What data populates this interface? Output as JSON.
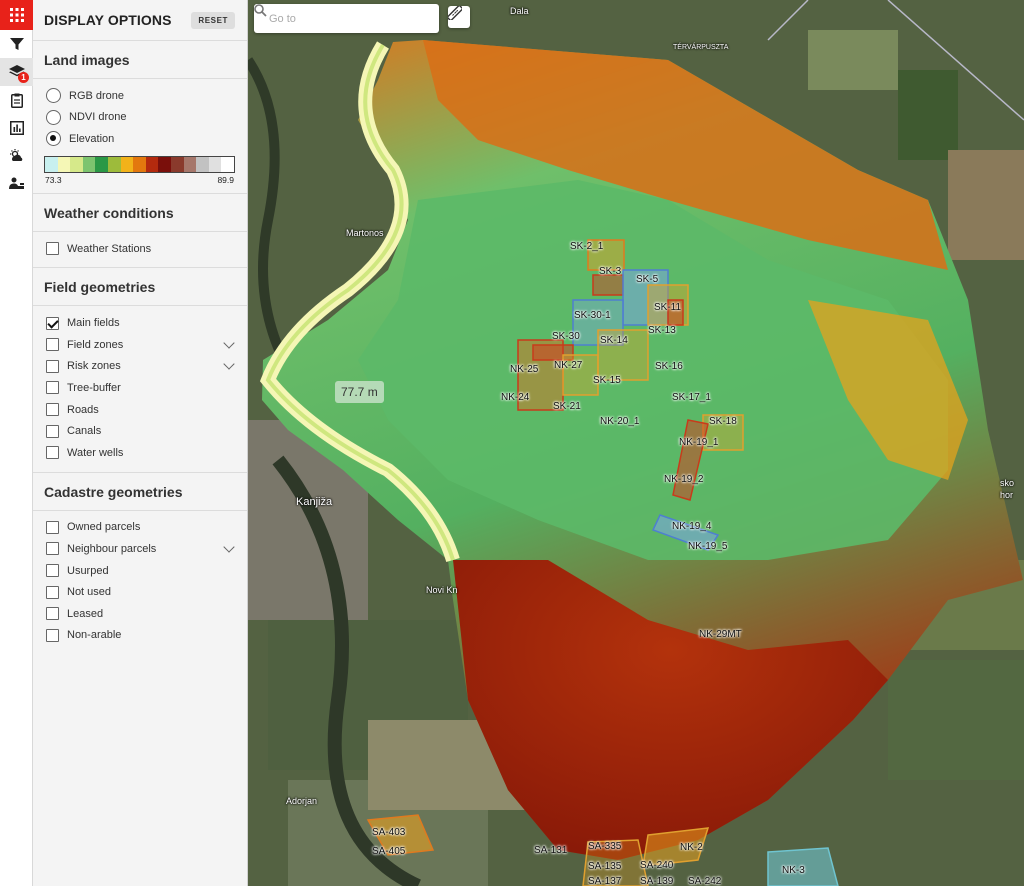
{
  "panel": {
    "title": "DISPLAY OPTIONS",
    "reset_label": "RESET",
    "rail_badge": "1"
  },
  "land_images": {
    "title": "Land images",
    "options": [
      {
        "label": "RGB drone",
        "selected": false
      },
      {
        "label": "NDVI drone",
        "selected": false
      },
      {
        "label": "Elevation",
        "selected": true
      }
    ],
    "legend": {
      "min": "73.3",
      "max": "89.9",
      "colors": [
        "#c8f0ef",
        "#f5f7b6",
        "#d6e98a",
        "#7cc46f",
        "#2a9846",
        "#9dbb3b",
        "#f2b21a",
        "#e3780e",
        "#b42a0e",
        "#7a0f0b",
        "#8a3a2c",
        "#a6776b",
        "#c2c2c2",
        "#e0e0e0",
        "#ffffff"
      ]
    }
  },
  "weather": {
    "title": "Weather conditions",
    "items": [
      {
        "label": "Weather Stations",
        "checked": false
      }
    ]
  },
  "field_geometries": {
    "title": "Field geometries",
    "items": [
      {
        "label": "Main fields",
        "checked": true,
        "expandable": false
      },
      {
        "label": "Field zones",
        "checked": false,
        "expandable": true
      },
      {
        "label": "Risk zones",
        "checked": false,
        "expandable": true
      },
      {
        "label": "Tree-buffer",
        "checked": false,
        "expandable": false
      },
      {
        "label": "Roads",
        "checked": false,
        "expandable": false
      },
      {
        "label": "Canals",
        "checked": false,
        "expandable": false
      },
      {
        "label": "Water wells",
        "checked": false,
        "expandable": false
      }
    ]
  },
  "cadastre": {
    "title": "Cadastre geometries",
    "items": [
      {
        "label": "Owned parcels",
        "checked": false,
        "expandable": false
      },
      {
        "label": "Neighbour parcels",
        "checked": false,
        "expandable": true
      },
      {
        "label": "Usurped",
        "checked": false,
        "expandable": false
      },
      {
        "label": "Not used",
        "checked": false,
        "expandable": false
      },
      {
        "label": "Leased",
        "checked": false,
        "expandable": false
      },
      {
        "label": "Non-arable",
        "checked": false,
        "expandable": false
      }
    ]
  },
  "map": {
    "search_placeholder": "Go to",
    "elevation_readout": "77.7 m",
    "places": [
      "Dala",
      "TÉRVÁRPUSZTA",
      "Martonos",
      "Kanjiža",
      "Novi Kn",
      "Adorjan",
      "sko",
      "hor"
    ],
    "field_labels": [
      "SK-2_1",
      "SK-3",
      "SK-5",
      "SK-11",
      "SK-30-1",
      "SK-13",
      "SK-30",
      "SK-14",
      "NK-25",
      "NK-27",
      "SK-16",
      "SK-15",
      "NK-24",
      "SK-21",
      "SK-17_1",
      "SK-18",
      "NK-20_1",
      "NK-19_1",
      "NK-19_2",
      "NK-19_4",
      "NK-19_5",
      "NK-29MT",
      "SA-403",
      "SA-405",
      "SA-131",
      "SA-335",
      "SA-135",
      "SA-240",
      "NK-2",
      "SA-137",
      "SA-139",
      "SA-242",
      "NK-3"
    ]
  }
}
